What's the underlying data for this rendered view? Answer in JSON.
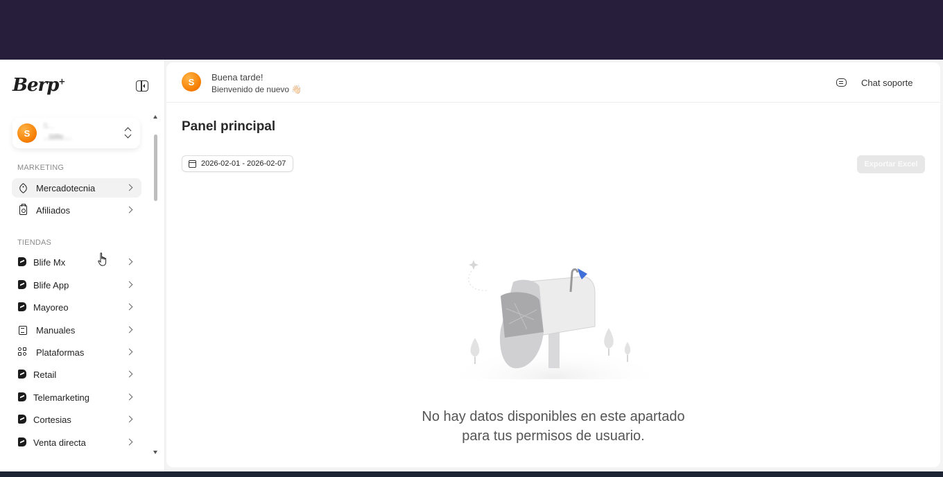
{
  "sidebar": {
    "logo_text": "Berp",
    "logo_mark": "+",
    "user": {
      "avatar_letter": "S",
      "name": "S...",
      "store": "...blife...."
    },
    "sections": [
      {
        "label": "MARKETING",
        "items": [
          {
            "label": "Mercadotecnia",
            "icon": "tag-icon",
            "active": true
          },
          {
            "label": "Afiliados",
            "icon": "badge-icon",
            "active": false
          }
        ]
      },
      {
        "label": "TIENDAS",
        "items": [
          {
            "label": "Blife Mx",
            "icon": "b-logo-icon"
          },
          {
            "label": "Blife App",
            "icon": "b-logo-icon"
          },
          {
            "label": "Mayoreo",
            "icon": "b-logo-icon"
          },
          {
            "label": "Manuales",
            "icon": "book-icon"
          },
          {
            "label": "Plataformas",
            "icon": "platforms-icon"
          },
          {
            "label": "Retail",
            "icon": "b-logo-icon"
          },
          {
            "label": "Telemarketing",
            "icon": "b-logo-icon"
          },
          {
            "label": "Cortesias",
            "icon": "b-logo-icon"
          },
          {
            "label": "Venta directa",
            "icon": "b-logo-icon"
          }
        ]
      }
    ]
  },
  "header": {
    "avatar_letter": "S",
    "greeting": "Buena tarde!",
    "welcome": "Bienvenido de nuevo 👋🏻",
    "chat_label": "Chat soporte"
  },
  "main": {
    "title": "Panel principal",
    "date_range": "2026-02-01 - 2026-02-07",
    "export_label": "Exportar Excel",
    "empty_line1": "No hay datos disponibles en este apartado",
    "empty_line2": "para tus permisos de usuario."
  },
  "colors": {
    "top_band": "#261e3a",
    "avatar": "#f57c00",
    "flag": "#3f6fd8"
  }
}
